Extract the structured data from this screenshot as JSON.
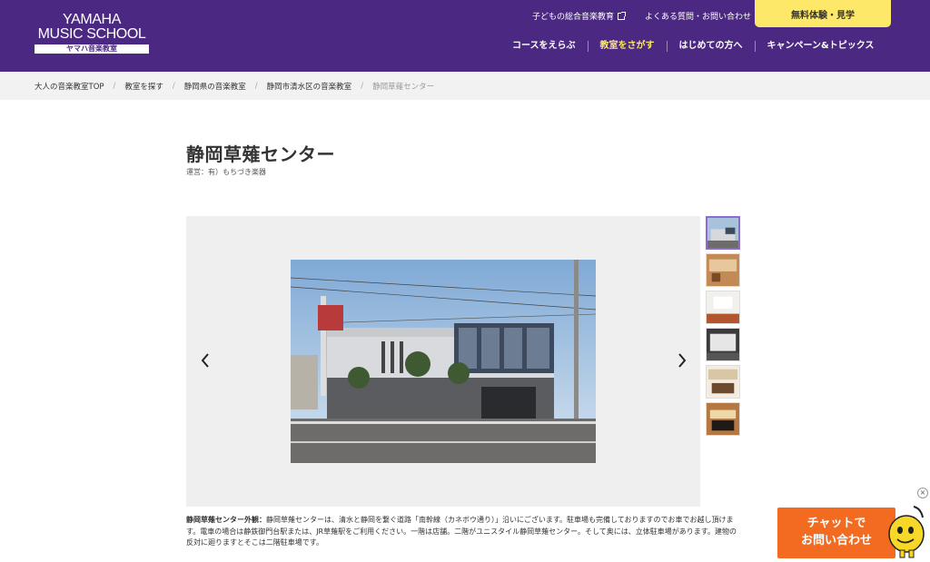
{
  "header": {
    "logo_line1": "YAMAHA",
    "logo_line2": "MUSIC SCHOOL",
    "logo_sub": "ヤマハ音楽教室",
    "util_links": [
      "子どもの総合音楽教育",
      "よくある質問・お問い合わせ"
    ],
    "trial_button": "無料体験・見学",
    "nav": [
      "コースをえらぶ",
      "教室をさがす",
      "はじめての方へ",
      "キャンペーン&トピックス"
    ],
    "nav_active_index": 1,
    "brand_color": "#4b2882",
    "accent_color": "#fde86a"
  },
  "breadcrumb": [
    "大人の音楽教室TOP",
    "教室を探す",
    "静岡県の音楽教室",
    "静岡市清水区の音楽教室",
    "静岡草薙センター"
  ],
  "page": {
    "title": "静岡草薙センター",
    "operator": "運営：有）もちづき楽器"
  },
  "gallery": {
    "thumb_count": 6,
    "selected_index": 0
  },
  "caption": {
    "label": "静岡草薙センター外観：",
    "text": "静岡草薙センターは、清水と静岡を繋ぐ道路「南幹線（カネボウ通り）」沿いにございます。駐車場も完備しておりますのでお車でお越し頂けます。電車の場合は静鉄御門台駅または、JR草薙駅をご利用ください。一階は店舗。二階がユニスタイル静岡草薙センター。そして奥には、立体駐車場があります。建物の反対に廻りますとそこは二階駐車場です。"
  },
  "chat": {
    "line1": "チャットで",
    "line2": "お問い合わせ",
    "close": "×",
    "color": "#f26b21"
  }
}
